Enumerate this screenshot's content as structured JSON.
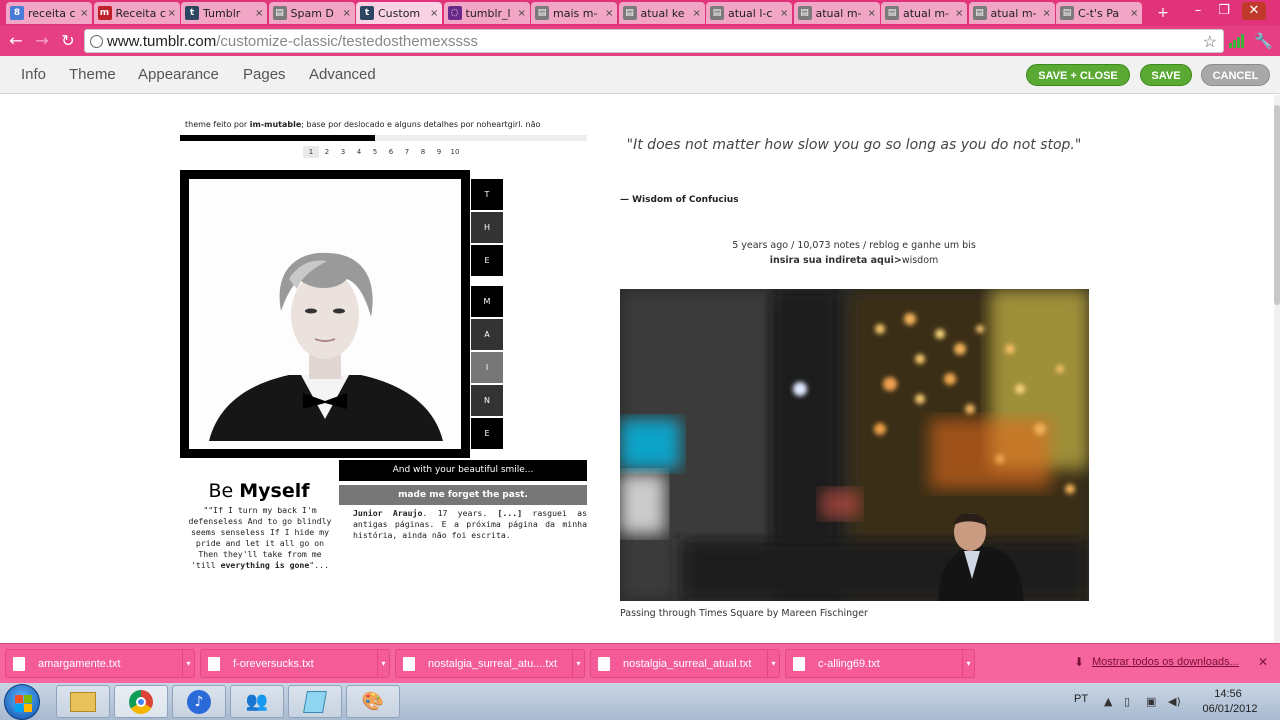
{
  "browser": {
    "tabs": [
      {
        "title": "receita c",
        "icon": "google-icon"
      },
      {
        "title": "Receita c",
        "icon": "receita-icon"
      },
      {
        "title": "Tumblr",
        "icon": "tumblr-icon"
      },
      {
        "title": "Spam D",
        "icon": "page-icon"
      },
      {
        "title": "Custom",
        "icon": "tumblr-icon",
        "active": true
      },
      {
        "title": "tumblr_l",
        "icon": "loading-icon"
      },
      {
        "title": "mais m-",
        "icon": "page-icon"
      },
      {
        "title": "atual ke",
        "icon": "page-icon"
      },
      {
        "title": "atual l-c",
        "icon": "page-icon"
      },
      {
        "title": "atual m-",
        "icon": "page-icon"
      },
      {
        "title": "atual m-",
        "icon": "page-icon"
      },
      {
        "title": "atual m-",
        "icon": "page-icon"
      },
      {
        "title": "C-t's Pa",
        "icon": "page-icon"
      }
    ],
    "url_domain": "www.tumblr.com",
    "url_path": "/customize-classic/testedosthemexssss"
  },
  "customize": {
    "menu": [
      "Info",
      "Theme",
      "Appearance",
      "Pages",
      "Advanced"
    ],
    "save_close": "SAVE + CLOSE",
    "save": "SAVE",
    "cancel": "CANCEL"
  },
  "sidebar": {
    "credits_pre": "theme feito por ",
    "credits_author": "im-mutable",
    "credits_post": "; base por deslocado e alguns detalhes por noheartgirl. não",
    "pages": [
      "1",
      "2",
      "3",
      "4",
      "5",
      "6",
      "7",
      "8",
      "9",
      "10"
    ],
    "vertical_letters": [
      "T",
      "H",
      "E",
      "M",
      "A",
      "I",
      "N",
      "E"
    ],
    "be": "Be ",
    "myself": "Myself",
    "quote_text": "\"\"If I turn my back I'm defenseless And to go blindly seems senseless If I hide my pride and let it all go on Then they'll take from me 'till ",
    "quote_bold": "everything is gone",
    "quote_end": "\"...",
    "smile_line": "And with your beautiful smile...",
    "forget_line": "made me forget the past.",
    "bio_name": "Junior Araujo",
    "bio_age": ". 17 years. ",
    "bio_ellipsis": "[...]",
    "bio_rest": " rasguei as antigas páginas. E a próxima página da minha história, ainda não foi escrita."
  },
  "post": {
    "quote": "\"It does not matter how slow you go so long as you do not stop.\"",
    "source": "— Wisdom of Confucius",
    "meta": "5 years ago / 10,073 notes / reblog e ganhe um bis",
    "tag_bold": "insira sua indireta aqui>",
    "tag_rest": "wisdom",
    "caption": "Passing through Times Square by Mareen Fischinger"
  },
  "downloads": {
    "files": [
      "amargamente.txt",
      "f-oreversucks.txt",
      "nostalgia_surreal_atu....txt",
      "nostalgia_surreal_atual.txt",
      "c-alling69.txt"
    ],
    "show_all": "Mostrar todos os downloads..."
  },
  "taskbar": {
    "lang": "PT",
    "time": "14:56",
    "date": "06/01/2012"
  },
  "colors": {
    "chrome_theme": "#e0337a",
    "save_green": "#5aa932",
    "cancel_grey": "#a8a8a8"
  }
}
